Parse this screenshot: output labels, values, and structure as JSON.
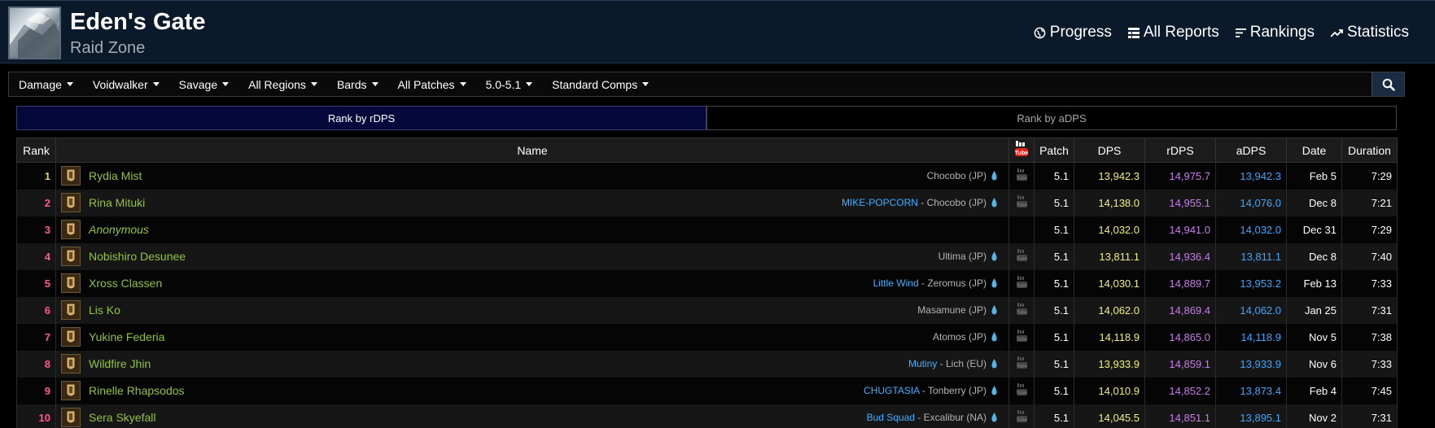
{
  "header": {
    "title": "Eden's Gate",
    "subtitle": "Raid Zone",
    "nav": [
      {
        "label": "Progress",
        "icon": "globe-icon"
      },
      {
        "label": "All Reports",
        "icon": "table-icon"
      },
      {
        "label": "Rankings",
        "icon": "rankings-icon"
      },
      {
        "label": "Statistics",
        "icon": "chart-line-icon"
      }
    ]
  },
  "filters": [
    "Damage",
    "Voidwalker",
    "Savage",
    "All Regions",
    "Bards",
    "All Patches",
    "5.0-5.1",
    "Standard Comps"
  ],
  "tabs": {
    "rdps": "Rank by rDPS",
    "adps": "Rank by aDPS",
    "active": "rdps"
  },
  "table": {
    "headers": {
      "rank": "Rank",
      "name": "Name",
      "patch": "Patch",
      "dps": "DPS",
      "rdps": "rDPS",
      "adps": "aDPS",
      "date": "Date",
      "duration": "Duration"
    },
    "colors": {
      "rank_top": "#e5cc80",
      "rank_other": "#ff5a8a",
      "player": "#92c23e",
      "dps": "#f0f07a",
      "rdps": "#c57fe8",
      "adps": "#3ea6ff",
      "fc": "#3eb0ff"
    },
    "rows": [
      {
        "rank": "1",
        "name": "Rydia Mist",
        "fc": "",
        "server": "Chocobo (JP)",
        "patch": "5.1",
        "dps": "13,942.3",
        "rdps": "14,975.7",
        "adps": "13,942.3",
        "date": "Feb 5",
        "duration": "7:29"
      },
      {
        "rank": "2",
        "name": "Rina Mituki",
        "fc": "MIKE-POPCORN",
        "server": "Chocobo (JP)",
        "patch": "5.1",
        "dps": "14,138.0",
        "rdps": "14,955.1",
        "adps": "14,076.0",
        "date": "Dec 8",
        "duration": "7:21"
      },
      {
        "rank": "3",
        "name": "Anonymous",
        "fc": "",
        "server": "",
        "patch": "5.1",
        "dps": "14,032.0",
        "rdps": "14,941.0",
        "adps": "14,032.0",
        "date": "Dec 31",
        "duration": "7:29"
      },
      {
        "rank": "4",
        "name": "Nobishiro Desunee",
        "fc": "",
        "server": "Ultima (JP)",
        "patch": "5.1",
        "dps": "13,811.1",
        "rdps": "14,936.4",
        "adps": "13,811.1",
        "date": "Dec 8",
        "duration": "7:40"
      },
      {
        "rank": "5",
        "name": "Xross Classen",
        "fc": "Little Wind",
        "server": "Zeromus (JP)",
        "patch": "5.1",
        "dps": "14,030.1",
        "rdps": "14,889.7",
        "adps": "13,953.2",
        "date": "Feb 13",
        "duration": "7:33"
      },
      {
        "rank": "6",
        "name": "Lis Ko",
        "fc": "",
        "server": "Masamune (JP)",
        "patch": "5.1",
        "dps": "14,062.0",
        "rdps": "14,869.4",
        "adps": "14,062.0",
        "date": "Jan 25",
        "duration": "7:31"
      },
      {
        "rank": "7",
        "name": "Yukine Federia",
        "fc": "",
        "server": "Atomos (JP)",
        "patch": "5.1",
        "dps": "14,118.9",
        "rdps": "14,865.0",
        "adps": "14,118.9",
        "date": "Nov 5",
        "duration": "7:38"
      },
      {
        "rank": "8",
        "name": "Wildfire Jhin",
        "fc": "Mutiny",
        "server": "Lich (EU)",
        "patch": "5.1",
        "dps": "13,933.9",
        "rdps": "14,859.1",
        "adps": "13,933.9",
        "date": "Nov 6",
        "duration": "7:33"
      },
      {
        "rank": "9",
        "name": "Rinelle Rhapsodos",
        "fc": "CHUGTASIA",
        "server": "Tonberry (JP)",
        "patch": "5.1",
        "dps": "14,010.9",
        "rdps": "14,852.2",
        "adps": "13,873.4",
        "date": "Feb 4",
        "duration": "7:45"
      },
      {
        "rank": "10",
        "name": "Sera Skyefall",
        "fc": "Bud Squad",
        "server": "Excalibur (NA)",
        "patch": "5.1",
        "dps": "14,045.5",
        "rdps": "14,851.1",
        "adps": "13,895.1",
        "date": "Nov 2",
        "duration": "7:31"
      }
    ]
  }
}
